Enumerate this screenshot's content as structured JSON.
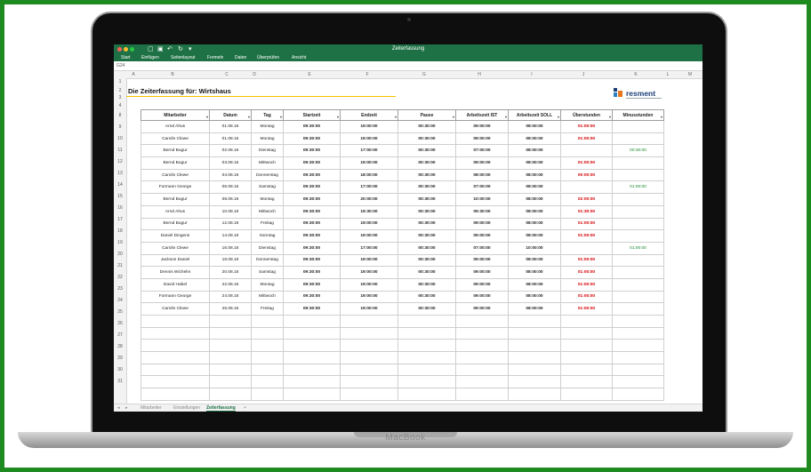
{
  "window_title": "Zeiterfassung",
  "menu": [
    "Start",
    "Einfügen",
    "Seitenlayout",
    "Formeln",
    "Daten",
    "Überprüfen",
    "Ansicht"
  ],
  "cell_ref": "G24",
  "column_letters": [
    "A",
    "B",
    "C",
    "D",
    "E",
    "F",
    "G",
    "H",
    "I",
    "J",
    "K",
    "L",
    "M"
  ],
  "row_numbers": [
    "1",
    "2",
    "3",
    "4",
    "8",
    "9",
    "10",
    "11",
    "12",
    "13",
    "14",
    "15",
    "16",
    "17",
    "18",
    "19",
    "20",
    "21",
    "22",
    "23",
    "24",
    "25",
    "26",
    "27",
    "28",
    "29",
    "30",
    "31"
  ],
  "sheet_title": "Die Zeiterfassung für: Wirtshaus",
  "logo_text": "resment",
  "headers": [
    "Mitarbeiter",
    "Datum",
    "Tag",
    "Startzeit",
    "Endzeit",
    "Pause",
    "Arbeitszeit IST",
    "Arbeitszeit SOLL",
    "Überstunden",
    "Minusstunden"
  ],
  "rows": [
    [
      "Arnd Ahus",
      "01.08.16",
      "Montag",
      "09:30:00",
      "19:00:00",
      "00:30:00",
      "09:00:00",
      "08:00:00",
      "01:00:00",
      ""
    ],
    [
      "Carolin Clewe",
      "01.08.16",
      "Montag",
      "09:30:00",
      "19:00:00",
      "00:30:00",
      "09:00:00",
      "08:00:00",
      "01:00:00",
      ""
    ],
    [
      "Bernd Bugur",
      "02.08.16",
      "Dienstag",
      "09:30:00",
      "17:00:00",
      "00:30:00",
      "07:00:00",
      "08:00:00",
      "",
      "00:30:00"
    ],
    [
      "Bernd Bugur",
      "03.08.16",
      "Mittwoch",
      "09:30:00",
      "19:00:00",
      "00:30:00",
      "09:00:00",
      "08:00:00",
      "01:00:00",
      ""
    ],
    [
      "Carolin Clewe",
      "04.08.16",
      "Donnerstag",
      "09:30:00",
      "18:00:00",
      "00:30:00",
      "08:00:00",
      "08:00:00",
      "00:00:00",
      ""
    ],
    [
      "Formann George",
      "06.08.16",
      "Samstag",
      "09:30:00",
      "17:00:00",
      "00:30:00",
      "07:00:00",
      "08:00:00",
      "",
      "01:00:00"
    ],
    [
      "Bernd Bugur",
      "08.08.16",
      "Montag",
      "09:30:00",
      "20:00:00",
      "00:30:00",
      "10:00:00",
      "08:00:00",
      "02:00:00",
      ""
    ],
    [
      "Arnd Ahus",
      "10.08.16",
      "Mittwoch",
      "09:30:00",
      "19:30:00",
      "00:30:00",
      "09:30:00",
      "08:00:00",
      "01:30:00",
      ""
    ],
    [
      "Bernd Bugur",
      "12.08.16",
      "Freitag",
      "09:30:00",
      "19:00:00",
      "00:30:00",
      "09:00:00",
      "08:00:00",
      "01:00:00",
      ""
    ],
    [
      "Daniel Dingens",
      "14.08.16",
      "Sonntag",
      "09:30:00",
      "19:00:00",
      "00:30:00",
      "09:00:00",
      "08:00:00",
      "01:00:00",
      ""
    ],
    [
      "Carolin Clewe",
      "16.08.16",
      "Dienstag",
      "09:30:00",
      "17:00:00",
      "00:30:00",
      "07:00:00",
      "10:00:00",
      "",
      "01:00:00"
    ],
    [
      "Jackson Daniel",
      "18.08.16",
      "Donnerstag",
      "09:30:00",
      "19:00:00",
      "00:30:00",
      "09:00:00",
      "08:00:00",
      "01:00:00",
      ""
    ],
    [
      "Dennis Wichelm",
      "20.08.16",
      "Samstag",
      "09:30:00",
      "19:00:00",
      "00:30:00",
      "09:00:00",
      "08:00:00",
      "01:00:00",
      ""
    ],
    [
      "David Habel",
      "22.08.16",
      "Montag",
      "09:30:00",
      "19:00:00",
      "00:30:00",
      "09:00:00",
      "08:00:00",
      "01:00:00",
      ""
    ],
    [
      "Formann George",
      "24.08.16",
      "Mittwoch",
      "09:30:00",
      "19:00:00",
      "00:30:00",
      "09:00:00",
      "08:00:00",
      "01:00:00",
      ""
    ],
    [
      "Carolin Clewe",
      "26.08.16",
      "Freitag",
      "09:30:00",
      "19:00:00",
      "00:30:00",
      "09:00:00",
      "08:00:00",
      "01:00:00",
      ""
    ]
  ],
  "empty_rows": 7,
  "sheet_tabs": [
    "Mitarbeiter",
    "Einstellungen",
    "Zeiterfassung"
  ],
  "brand": "MacBook",
  "colors": {
    "accent": "#1e7145",
    "overtime": "#d40000",
    "minus": "#1a8a2e",
    "title_underline": "#f2c300",
    "logo": "#1c3f78"
  }
}
